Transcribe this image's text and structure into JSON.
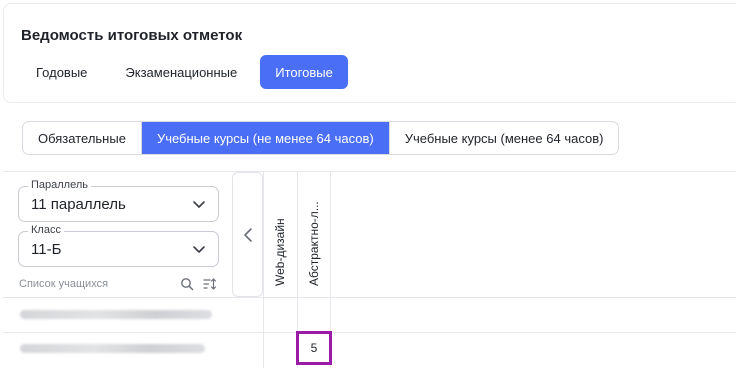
{
  "header": {
    "title": "Ведомость итоговых отметок",
    "period_tabs": [
      {
        "label": "Годовые",
        "active": false
      },
      {
        "label": "Экзаменационные",
        "active": false
      },
      {
        "label": "Итоговые",
        "active": true
      }
    ]
  },
  "course_filter": {
    "items": [
      {
        "label": "Обязательные",
        "active": false
      },
      {
        "label": "Учебные курсы (не менее 64 часов)",
        "active": true
      },
      {
        "label": "Учебные курсы (менее 64 часов)",
        "active": false
      }
    ]
  },
  "sidebar": {
    "parallel": {
      "legend": "Параллель",
      "value": "11 параллель"
    },
    "class": {
      "legend": "Класс",
      "value": "11-Б"
    },
    "student_list_label": "Список учащихся",
    "icons": {
      "search": "search-icon",
      "sort": "sort-icon",
      "collapse": "chevron-left-icon"
    }
  },
  "grid": {
    "columns": [
      "Web-дизайн",
      "Абстрактно-л..."
    ],
    "rows": [
      {
        "student": "",
        "grades": [
          "",
          ""
        ]
      },
      {
        "student": "",
        "grades": [
          "",
          "5"
        ]
      }
    ]
  },
  "colors": {
    "accent": "#4a6ef5",
    "highlight": "#9c1aa8"
  }
}
